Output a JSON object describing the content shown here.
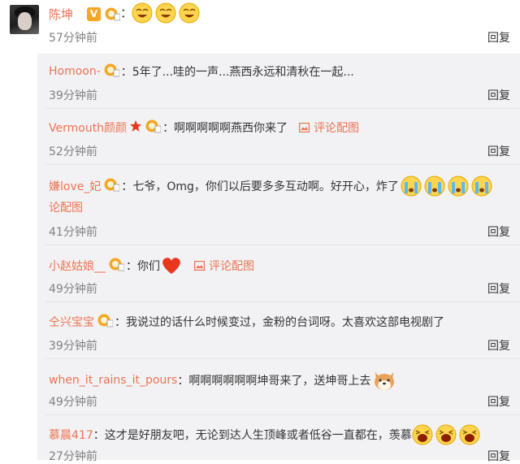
{
  "post": {
    "author": "陈坤",
    "badge": "V",
    "colon": "：",
    "time": "57分钟前",
    "reply_label": "回复",
    "emoji_icons": [
      "smile-emoji-icon",
      "smile-emoji-icon",
      "smile-emoji-icon"
    ]
  },
  "comments": [
    {
      "name": "Homoon-",
      "text": "：5年了...哇的一声...燕西永远和清秋在一起...",
      "time": "39分钟前",
      "reply": "回复"
    },
    {
      "name": "Vermouth颜颜",
      "text": "：啊啊啊啊啊燕西你来了",
      "picture_label": "评论配图",
      "time": "52分钟前",
      "reply": "回复"
    },
    {
      "name": "嫌love_妃",
      "text": "：七爷，Omg，你们以后要多多互动啊。好开心，炸了",
      "text_cont": "论配图",
      "time": "41分钟前",
      "reply": "回复"
    },
    {
      "name": "小赵姑娘__",
      "text": "：你们",
      "picture_label": "评论配图",
      "time": "49分钟前",
      "reply": "回复"
    },
    {
      "name": "仝兴宝宝",
      "text": "：我说过的话什么时候变过，金粉的台词呀。太喜欢这部电视剧了",
      "time": "39分钟前",
      "reply": "回复"
    },
    {
      "name": "when_it_rains_it_pours",
      "text": "：啊啊啊啊啊啊坤哥来了，送坤哥上去",
      "time": "49分钟前",
      "reply": "回复"
    },
    {
      "name": "慕晨417",
      "text": "：这才是好朋友吧，无论到达人生顶峰或者低谷一直都在，羡慕",
      "time": "27分钟前",
      "reply": "回复"
    }
  ],
  "colors": {
    "name": "#eb7350",
    "panel": "#f2f2f5",
    "time": "#808080"
  }
}
